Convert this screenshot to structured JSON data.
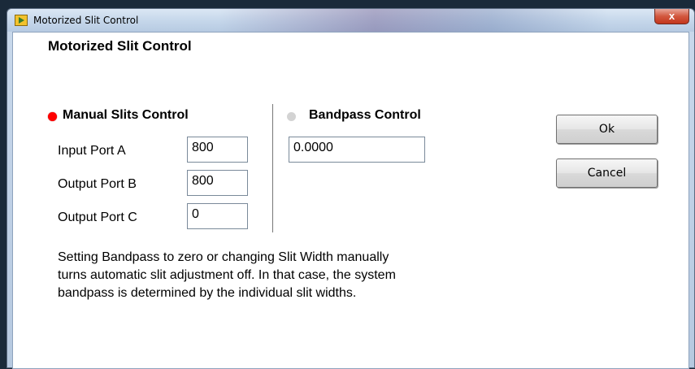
{
  "window": {
    "title": "Motorized Slit Control",
    "close_label": "x"
  },
  "heading": "Motorized Slit Control",
  "manual": {
    "label": "Manual Slits Control",
    "led_color": "#ff0000",
    "rows": [
      {
        "label": "Input Port A",
        "value": "800"
      },
      {
        "label": "Output Port B",
        "value": "800"
      },
      {
        "label": "Output Port C",
        "value": "0"
      }
    ]
  },
  "bandpass": {
    "label": "Bandpass Control",
    "led_color": "#d3d3d3",
    "value": "0.0000"
  },
  "buttons": {
    "ok": "Ok",
    "cancel": "Cancel"
  },
  "note": [
    "Setting Bandpass to zero or changing Slit Width manually",
    "turns automatic slit adjustment off.  In that case, the system",
    "bandpass is determined  by the individual slit widths."
  ]
}
